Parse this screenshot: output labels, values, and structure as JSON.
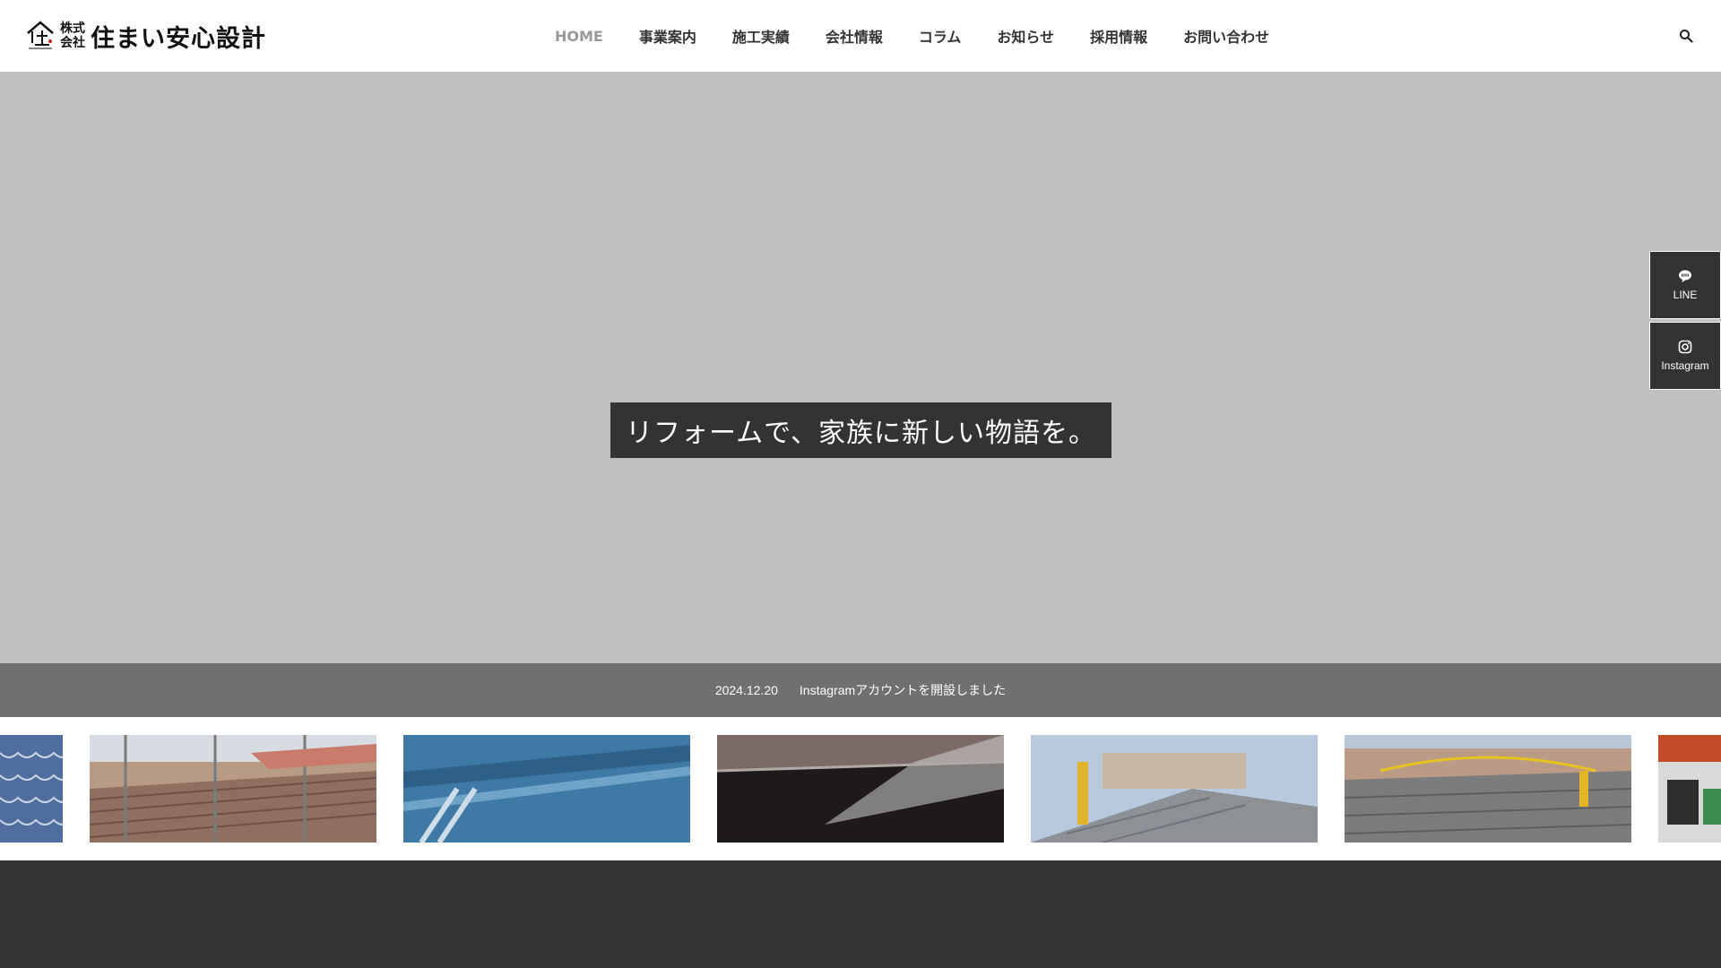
{
  "header": {
    "logo": {
      "corp_line1": "株式",
      "corp_line2": "会社",
      "name": "住まい安心設計",
      "mark_text": "安心設計"
    },
    "nav": [
      {
        "label": "HOME",
        "active": true
      },
      {
        "label": "事業案内"
      },
      {
        "label": "施工実績"
      },
      {
        "label": "会社情報"
      },
      {
        "label": "コラム"
      },
      {
        "label": "お知らせ"
      },
      {
        "label": "採用情報"
      },
      {
        "label": "お問い合わせ"
      }
    ],
    "search_icon": "search-icon"
  },
  "hero": {
    "catchphrase": "リフォームで、家族に新しい物語を。"
  },
  "side": {
    "line_label": "LINE",
    "instagram_label": "Instagram"
  },
  "news": {
    "date": "2024.12.20",
    "title": "Instagramアカウントを開設しました"
  },
  "gallery": {
    "items": [
      "roof-tile-blue",
      "roof-scaffold-ridge",
      "blue-roof-pipe",
      "dark-wet-roof",
      "roof-with-ladder",
      "roof-with-rope",
      "orange-building-edge"
    ]
  },
  "colors": {
    "hero_bg": "#c0c0c0",
    "news_bg": "#707070",
    "footer_bg": "#333333",
    "nav_active": "#999999"
  }
}
